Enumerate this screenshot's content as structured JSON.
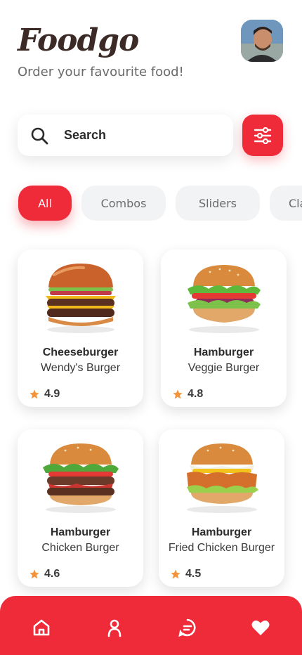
{
  "header": {
    "brand": "Foodgo",
    "tagline": "Order your favourite food!"
  },
  "search": {
    "placeholder": "Search",
    "icon": "search-icon"
  },
  "filter": {
    "icon": "sliders-icon"
  },
  "categories": {
    "items": [
      {
        "label": "All",
        "active": true
      },
      {
        "label": "Combos",
        "active": false
      },
      {
        "label": "Sliders",
        "active": false
      },
      {
        "label": "Classic",
        "active": false
      }
    ]
  },
  "products": [
    {
      "title": "Cheeseburger",
      "subtitle": "Wendy's Burger",
      "rating": "4.9"
    },
    {
      "title": "Hamburger",
      "subtitle": "Veggie Burger",
      "rating": "4.8"
    },
    {
      "title": "Hamburger",
      "subtitle": "Chicken Burger",
      "rating": "4.6"
    },
    {
      "title": "Hamburger",
      "subtitle": "Fried Chicken Burger",
      "rating": "4.5"
    }
  ],
  "nav": {
    "items": [
      "home-icon",
      "profile-icon",
      "chat-icon",
      "heart-icon"
    ]
  },
  "colors": {
    "accent": "#ef2a39",
    "brand_text": "#3c2a26",
    "star": "#f3943a",
    "chip_bg": "#f2f3f5"
  }
}
